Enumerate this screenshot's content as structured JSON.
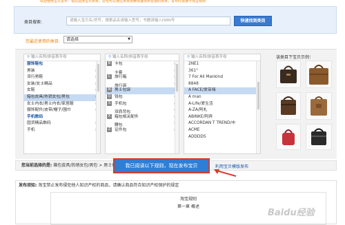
{
  "top_strip": "欢迎使用宝贝发布：请先选择宝贝类目，您也可以通过类目搜索快速找到合适的类目，发布时请遵守淘宝规则",
  "search": {
    "label": "类目搜索:",
    "placeholder": "请输入宝贝名/货号，搜索品名请输入型号，书籍请输入ISBN号",
    "button": "快速找到类目"
  },
  "recent": {
    "label": "您最近使用的类目:",
    "selected": "请选择"
  },
  "columns": {
    "col1": {
      "placeholder": "输入名称/拼音首字母",
      "items": [
        {
          "label": "服饰鞋包",
          "type": "hdr"
        },
        {
          "label": "男装",
          "type": "cat"
        },
        {
          "label": "流行男鞋",
          "type": "cat"
        },
        {
          "label": "女装/女士精品",
          "type": "cat"
        },
        {
          "label": "女鞋",
          "type": "cat"
        },
        {
          "label": "箱包皮具/热销女包/男包",
          "type": "sel"
        },
        {
          "label": "女士内衣/男士内衣/家居服",
          "type": "cat"
        },
        {
          "label": "服饰配件/皮带/帽子/围巾",
          "type": "cat"
        },
        {
          "label": "手机数码",
          "type": "hdr"
        },
        {
          "label": "国货精品数码",
          "type": "cat"
        },
        {
          "label": "手机",
          "type": "cat"
        }
      ]
    },
    "col2": {
      "placeholder": "输入名称/拼音首字母",
      "items": [
        {
          "letter": "B",
          "label": "卡包"
        },
        {
          "letter": "",
          "label": "卡套"
        },
        {
          "letter": "L",
          "label": "旅行箱"
        },
        {
          "letter": "",
          "label": "旅行袋"
        },
        {
          "letter": "N",
          "label": "男士包袋",
          "type": "sel"
        },
        {
          "letter": "Q",
          "label": "钱包"
        },
        {
          "letter": "S",
          "label": "手机包"
        },
        {
          "letter": "",
          "label": "双肩背包"
        },
        {
          "letter": "X",
          "label": "箱包相关配件"
        },
        {
          "letter": "",
          "label": "腰包"
        },
        {
          "letter": "Z",
          "label": "证件包"
        }
      ]
    },
    "col3": {
      "placeholder": "输入名称/拼音首字母",
      "items": [
        {
          "label": "2NE1"
        },
        {
          "label": "361°"
        },
        {
          "label": "7 For All Mankind"
        },
        {
          "label": "8848"
        },
        {
          "label": "A FACE/爱菲嗨",
          "type": "sel"
        },
        {
          "label": "A man"
        },
        {
          "label": "A-Life/爱生活"
        },
        {
          "label": "A-ZA/阿札"
        },
        {
          "label": "ABINKE/阿宾"
        },
        {
          "label": "ACCORDAN T TREND/中"
        },
        {
          "label": "ACME"
        },
        {
          "label": "ADDDDS"
        }
      ]
    }
  },
  "samples_title": "该类目下宝贝示例：",
  "selected_bar": {
    "label": "您当前选择的是:",
    "path": "箱包皮具/热销女包/男包 > 男士包袋 > A FACE/爱菲嗨"
  },
  "publish_button": "我已阅读以下规则，现在发布宝贝",
  "template_link": "利用宝贝模版发布",
  "notice": {
    "label": "发布须知:",
    "text": "淘宝禁止发布侵犯他人知识产权的商品，请确认商品符合知识产权保护的规定",
    "rule_title": "淘宝规则",
    "chapter": "第一章 概述"
  },
  "watermark": "Baidu经验"
}
